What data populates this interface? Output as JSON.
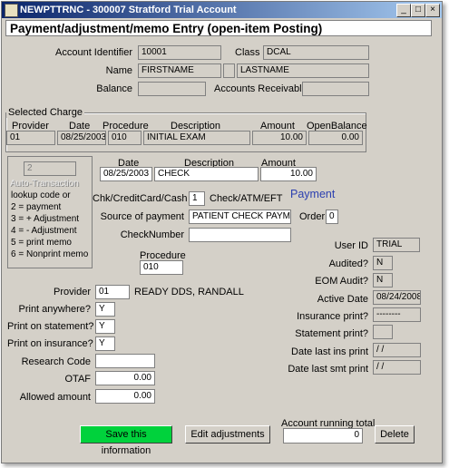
{
  "window": {
    "title": "NEWPTTRNC - 300007 Stratford Trial Account",
    "controls": [
      "_",
      "□",
      "×"
    ]
  },
  "header": {
    "title": "Payment/adjustment/memo Entry (open-item Posting)"
  },
  "account": {
    "identifier_label": "Account Identifier",
    "identifier": "10001",
    "class_label": "Class",
    "class": "DCAL",
    "name_label": "Name",
    "first_name": "FIRSTNAME",
    "middle_initial": "",
    "last_name": "LASTNAME",
    "balance_label": "Balance",
    "balance": "",
    "ar_label": "Accounts Receivable",
    "ar": ""
  },
  "selected_charge": {
    "title": "Selected Charge",
    "headers": {
      "provider": "Provider",
      "date": "Date",
      "procedure": "Procedure",
      "description": "Description",
      "amount": "Amount",
      "open_balance": "OpenBalance"
    },
    "row": {
      "provider": "01",
      "date": "08/25/2003",
      "procedure": "010",
      "description": "INITIAL EXAM",
      "amount": "10.00",
      "open_balance": "0.00"
    }
  },
  "auto_transaction": {
    "value": "2",
    "title": "Auto-Transaction",
    "lines": [
      "lookup code or",
      "2 = payment",
      "3 = + Adjustment",
      "4 = - Adjustment",
      "5 = print memo",
      "6 = Nonprint memo"
    ]
  },
  "entry": {
    "date_label": "Date",
    "date": "08/25/2003",
    "description_label": "Description",
    "description": "CHECK",
    "amount_label": "Amount",
    "amount": "10.00",
    "type_label": "Payment",
    "chk_label": "Chk/CreditCard/Cash",
    "chk_value": "1",
    "chk_desc": "Check/ATM/EFT",
    "source_label": "Source of payment",
    "source": "PATIENT CHECK PAYME",
    "order_label": "Order",
    "order": "0",
    "checknumber_label": "CheckNumber",
    "checknumber": "",
    "procedure_label": "Procedure",
    "procedure": "010"
  },
  "left_fields": {
    "provider_label": "Provider",
    "provider": "01",
    "provider_name": "READY DDS, RANDALL",
    "print_anywhere_label": "Print anywhere?",
    "print_anywhere": "Y",
    "print_statement_label": "Print on statement?",
    "print_statement": "Y",
    "print_insurance_label": "Print on insurance?",
    "print_insurance": "Y",
    "research_label": "Research Code",
    "research": "",
    "otaf_label": "OTAF",
    "otaf": "0.00",
    "allowed_label": "Allowed amount",
    "allowed": "0.00"
  },
  "right_fields": {
    "userid_label": "User ID",
    "userid": "TRIAL",
    "audited_label": "Audited?",
    "audited": "N",
    "eom_label": "EOM Audit?",
    "eom": "N",
    "active_label": "Active Date",
    "active": "08/24/2008",
    "ins_print_label": "Insurance print?",
    "ins_print": "--------",
    "stmt_print_label": "Statement print?",
    "stmt_print": "",
    "last_ins_label": "Date last ins print",
    "last_ins": " / /",
    "last_smt_label": "Date last smt print",
    "last_smt": " / /"
  },
  "footer": {
    "save": "Save this information",
    "edit": "Edit adjustments",
    "running_total_label": "Account running total",
    "running_total": "0",
    "delete": "Delete"
  },
  "colors": {
    "title_start": "#0a246a",
    "title_end": "#a6caf0",
    "save_button": "#00d23c",
    "payment_text": "#2b3fb0"
  }
}
